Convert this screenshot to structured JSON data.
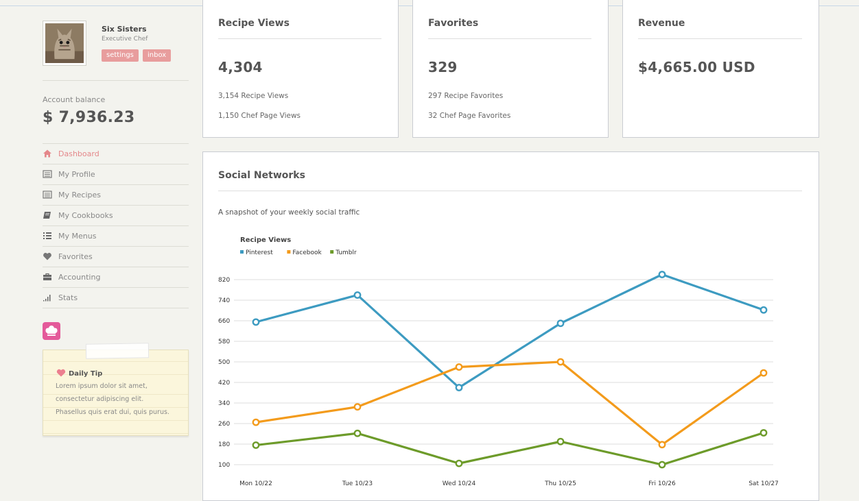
{
  "profile": {
    "name": "Six Sisters",
    "role": "Executive Chef",
    "settings_label": "settings",
    "inbox_label": "inbox"
  },
  "balance": {
    "label": "Account balance",
    "value": "$ 7,936.23"
  },
  "nav": [
    {
      "label": "Dashboard",
      "icon": "home-icon",
      "active": true
    },
    {
      "label": "My Profile",
      "icon": "list-icon"
    },
    {
      "label": "My Recipes",
      "icon": "list-icon"
    },
    {
      "label": "My Cookbooks",
      "icon": "book-icon"
    },
    {
      "label": "My Menus",
      "icon": "menu-icon"
    },
    {
      "label": "Favorites",
      "icon": "heart-icon"
    },
    {
      "label": "Accounting",
      "icon": "briefcase-icon"
    },
    {
      "label": "Stats",
      "icon": "bars-icon"
    }
  ],
  "tip": {
    "title": "Daily Tip",
    "lines": [
      "Lorem ipsum dolor sit amet,",
      "consectetur adipiscing elit.",
      "Phasellus quis erat dui, quis purus."
    ]
  },
  "cards": {
    "views": {
      "title": "Recipe Views",
      "big": "4,304",
      "lines": [
        "3,154 Recipe Views",
        "1,150 Chef Page Views"
      ]
    },
    "favorites": {
      "title": "Favorites",
      "big": "329",
      "lines": [
        "297 Recipe Favorites",
        "32 Chef Page Favorites"
      ]
    },
    "revenue": {
      "title": "Revenue",
      "big": "$4,665.00 USD"
    }
  },
  "social": {
    "title": "Social Networks",
    "description": "A snapshot of your weekly social traffic"
  },
  "colors": {
    "accent": "#e89d9d",
    "pinterest": "#3d9bc1",
    "facebook": "#f39b1c",
    "tumblr": "#6d9b2a"
  },
  "chart_data": {
    "type": "line",
    "title": "Recipe Views",
    "categories": [
      "Mon 10/22",
      "Tue 10/23",
      "Wed 10/24",
      "Thu 10/25",
      "Fri 10/26",
      "Sat 10/27"
    ],
    "yticks": [
      100,
      180,
      260,
      340,
      420,
      500,
      580,
      660,
      740,
      820
    ],
    "ylim": [
      100,
      820
    ],
    "grid": true,
    "legend": "top-left",
    "series": [
      {
        "name": "Pinterest",
        "color": "#3d9bc1",
        "values": [
          655,
          760,
          400,
          650,
          840,
          702
        ]
      },
      {
        "name": "Facebook",
        "color": "#f39b1c",
        "values": [
          265,
          325,
          480,
          500,
          178,
          457
        ]
      },
      {
        "name": "Tumblr",
        "color": "#6d9b2a",
        "values": [
          176,
          222,
          105,
          190,
          100,
          224
        ]
      }
    ]
  }
}
